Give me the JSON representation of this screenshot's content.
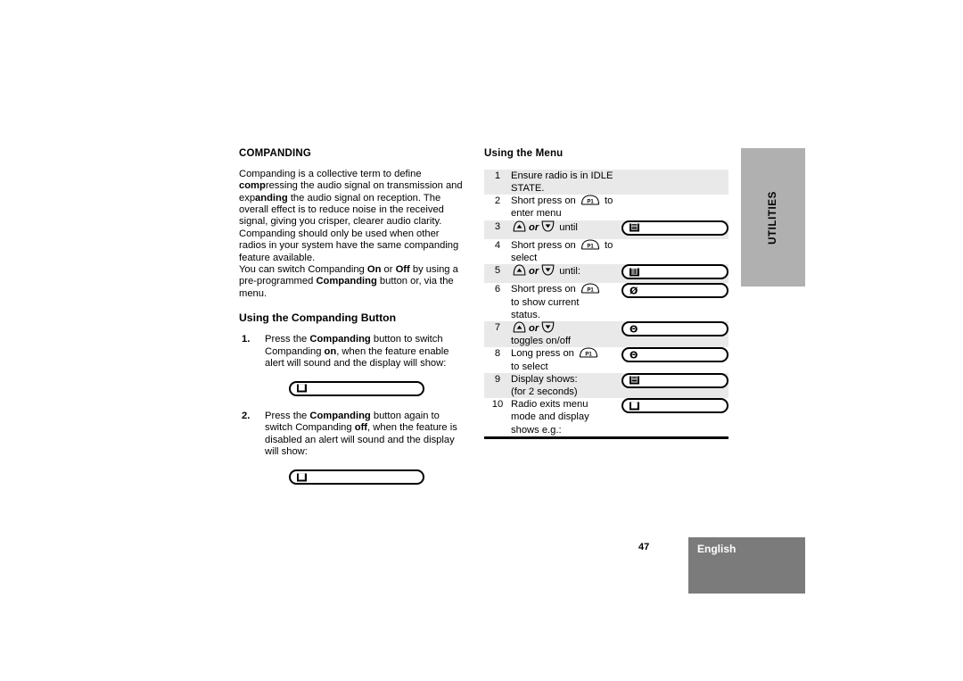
{
  "document": {
    "page_number": "47",
    "language_label": "English",
    "side_tab_label": "UTILITIES"
  },
  "left_column": {
    "section_title": "COMPANDING",
    "paragraphs": [
      {
        "runs": [
          {
            "text": "Companding is a collective term to define ",
            "bold": false
          },
          {
            "text": "comp",
            "bold": true
          },
          {
            "text": "ressing the audio signal on transmission and exp",
            "bold": false
          },
          {
            "text": "anding",
            "bold": true
          },
          {
            "text": " the audio signal on reception. The overall effect is to reduce noise in the received signal, giving you crisper, clearer audio clarity. Companding should only be used when other radios in your system have the same companding feature available.",
            "bold": false
          }
        ]
      },
      {
        "runs": [
          {
            "text": "You can switch Companding ",
            "bold": false
          },
          {
            "text": "On",
            "bold": true
          },
          {
            "text": " or ",
            "bold": false
          },
          {
            "text": "Off",
            "bold": true
          },
          {
            "text": " by using a pre-programmed ",
            "bold": false
          },
          {
            "text": "Companding",
            "bold": true
          },
          {
            "text": " button or, via the menu.",
            "bold": false
          }
        ]
      }
    ],
    "sub_title": "Using the Companding Button",
    "steps": [
      {
        "number": "1.",
        "runs": [
          {
            "text": "Press the ",
            "bold": false
          },
          {
            "text": "Companding",
            "bold": true
          },
          {
            "text": " button to switch Companding ",
            "bold": false
          },
          {
            "text": "on",
            "bold": true
          },
          {
            "text": ", when the feature enable alert  will sound and the display will show:",
            "bold": false
          }
        ],
        "display": {
          "glyph": "companding-on-icon",
          "glyph_char": "■"
        }
      },
      {
        "number": "2.",
        "runs": [
          {
            "text": "Press the ",
            "bold": false
          },
          {
            "text": "Companding",
            "bold": true
          },
          {
            "text": " button again to switch Companding ",
            "bold": false
          },
          {
            "text": "off",
            "bold": true
          },
          {
            "text": ", when the feature is disabled an alert  will sound and the display will show:",
            "bold": false
          }
        ],
        "display": {
          "glyph": "companding-off-icon",
          "glyph_char": "■"
        }
      }
    ]
  },
  "right_column": {
    "title": "Using the Menu",
    "table": {
      "rows": [
        {
          "number": "1",
          "lines": [
            {
              "parts": [
                {
                  "type": "text",
                  "value": "Ensure radio is in IDLE STATE."
                }
              ]
            }
          ],
          "display": null,
          "shaded": true
        },
        {
          "number": "2",
          "lines": [
            {
              "parts": [
                {
                  "type": "text",
                  "value": "Short press on"
                },
                {
                  "type": "key",
                  "value": "P1"
                },
                {
                  "type": "text",
                  "value": "to enter menu"
                }
              ]
            }
          ],
          "display": null,
          "shaded": false
        },
        {
          "number": "3",
          "lines": [
            {
              "parts": [
                {
                  "type": "key-up",
                  "value": "up-arrow-key"
                },
                {
                  "type": "or",
                  "value": "or"
                },
                {
                  "type": "key-down",
                  "value": "down-arrow-key"
                },
                {
                  "type": "text",
                  "value": "until"
                }
              ]
            }
          ],
          "display": {
            "glyph": "menu-companding-icon",
            "glyph_char": "▤"
          },
          "shaded": true
        },
        {
          "number": "4",
          "lines": [
            {
              "parts": [
                {
                  "type": "text",
                  "value": "Short press on"
                },
                {
                  "type": "key",
                  "value": "P1"
                },
                {
                  "type": "text",
                  "value": "to select"
                }
              ]
            }
          ],
          "display": null,
          "shaded": false
        },
        {
          "number": "5",
          "lines": [
            {
              "parts": [
                {
                  "type": "key-up",
                  "value": "up-arrow-key"
                },
                {
                  "type": "or",
                  "value": "or"
                },
                {
                  "type": "key-down",
                  "value": "down-arrow-key"
                },
                {
                  "type": "text",
                  "value": "until:"
                }
              ]
            }
          ],
          "display": {
            "glyph": "submenu-icon",
            "glyph_char": "▥"
          },
          "shaded": true
        },
        {
          "number": "6",
          "lines": [
            {
              "parts": [
                {
                  "type": "text",
                  "value": "Short press on"
                },
                {
                  "type": "key",
                  "value": "P1"
                }
              ]
            },
            {
              "parts": [
                {
                  "type": "text",
                  "value": "to show current"
                }
              ]
            },
            {
              "parts": [
                {
                  "type": "text",
                  "value": "status."
                }
              ]
            }
          ],
          "display": {
            "glyph": "status-off-icon",
            "glyph_char": "Ø",
            "hollow": true
          },
          "shaded": false
        },
        {
          "number": "7",
          "lines": [
            {
              "parts": [
                {
                  "type": "key-up",
                  "value": "up-arrow-key"
                },
                {
                  "type": "or",
                  "value": "or"
                },
                {
                  "type": "key-down",
                  "value": "down-arrow-key"
                }
              ]
            },
            {
              "parts": [
                {
                  "type": "text",
                  "value": "toggles on/off"
                }
              ]
            }
          ],
          "display": {
            "glyph": "status-on-icon",
            "glyph_char": "Θ",
            "hollow": true
          },
          "shaded": true
        },
        {
          "number": "8",
          "lines": [
            {
              "parts": [
                {
                  "type": "text",
                  "value": "Long press on"
                },
                {
                  "type": "key",
                  "value": "P1"
                }
              ]
            },
            {
              "parts": [
                {
                  "type": "text",
                  "value": "to select"
                }
              ]
            }
          ],
          "display": {
            "glyph": "status-on-icon",
            "glyph_char": "Θ",
            "hollow": true
          },
          "shaded": false
        },
        {
          "number": "9",
          "lines": [
            {
              "parts": [
                {
                  "type": "text",
                  "value": "Display shows:"
                }
              ]
            },
            {
              "parts": [
                {
                  "type": "text",
                  "value": "(for 2 seconds)"
                }
              ]
            }
          ],
          "display": {
            "glyph": "menu-companding-icon",
            "glyph_char": "▤"
          },
          "shaded": true
        },
        {
          "number": "10",
          "lines": [
            {
              "parts": [
                {
                  "type": "text",
                  "value": "Radio exits menu"
                }
              ]
            },
            {
              "parts": [
                {
                  "type": "text",
                  "value": "mode and display"
                }
              ]
            },
            {
              "parts": [
                {
                  "type": "text",
                  "value": "shows e.g.:"
                }
              ]
            }
          ],
          "display": {
            "glyph": "channel-icon",
            "glyph_char": "■"
          },
          "shaded": false
        }
      ]
    }
  },
  "colors": {
    "table_shade": "#e9e9e9",
    "side_tab_bg": "#b0b0b0",
    "footer_bg": "#7b7b7b",
    "text": "#000000"
  }
}
